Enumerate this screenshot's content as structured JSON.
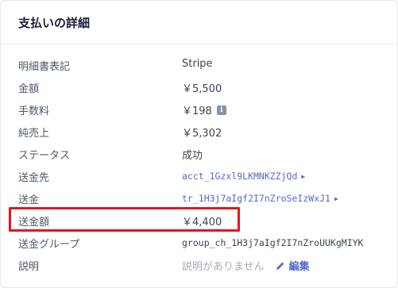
{
  "header": {
    "title": "支払いの詳細"
  },
  "rows": [
    {
      "label": "明細書表記",
      "value": "Stripe"
    },
    {
      "label": "金額",
      "value": "￥5,500"
    },
    {
      "label": "手数料",
      "value": "￥198"
    },
    {
      "label": "純売上",
      "value": "￥5,302"
    },
    {
      "label": "ステータス",
      "value": "成功"
    },
    {
      "label": "送金先",
      "value": "acct_1Gzxl9LKMNKZZjQd"
    },
    {
      "label": "送金",
      "value": "tr_1H3j7aIgf2I7nZroSeIzWxJ1"
    },
    {
      "label": "送金額",
      "value": "￥4,400"
    },
    {
      "label": "送金グループ",
      "value": "group_ch_1H3j7aIgf2I7nZroUUKgMIYK"
    },
    {
      "label": "説明",
      "value": "説明がありません",
      "edit_label": "編集"
    }
  ],
  "icons": {
    "info": "info-icon",
    "edit": "pencil-icon",
    "caret": "caret-right-icon"
  },
  "colors": {
    "link": "#5469d4",
    "highlight": "#e8121e"
  }
}
